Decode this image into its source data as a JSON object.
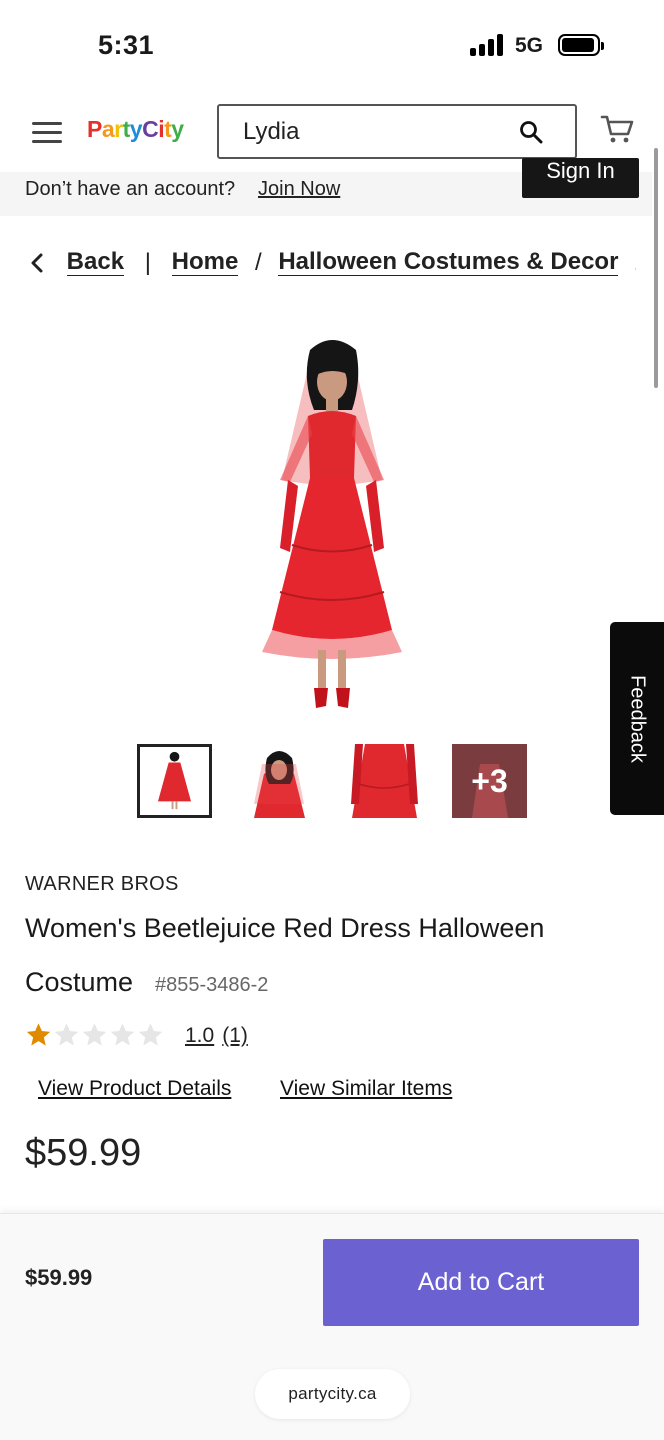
{
  "status_bar": {
    "time": "5:31",
    "network": "5G"
  },
  "header": {
    "logo": {
      "word1": "Party",
      "word2": "City",
      "colors": [
        "#e4322b",
        "#f39a1e",
        "#f2c200",
        "#3fae49",
        "#1f8dd6",
        "#6b3fa0",
        "#e4322b",
        "#f39a1e",
        "#3fae49"
      ]
    },
    "search": {
      "value": "Lydia",
      "placeholder": ""
    }
  },
  "account_bar": {
    "message": "Don’t have an account?",
    "join_label": "Join Now",
    "sign_in_label": "Sign In"
  },
  "breadcrumb": {
    "back": "Back",
    "items": [
      "Home",
      "Halloween Costumes & Decor",
      ""
    ],
    "separator": "/"
  },
  "feedback_label": "Feedback",
  "gallery": {
    "thumbnails": [
      "full-dress",
      "veil-closeup",
      "dress-detail"
    ],
    "more_label": "+3",
    "selected_index": 0
  },
  "product": {
    "brand": "WARNER BROS",
    "title_line1": "Women's Beetlejuice Red Dress Halloween",
    "title_line2": "Costume",
    "sku": "#855-3486-2",
    "rating_value": "1.0",
    "rating_count": "(1)",
    "rating_stars": 1,
    "rating_max": 5,
    "view_details": "View Product Details",
    "view_similar": "View Similar Items",
    "price": "$59.99"
  },
  "bottom_bar": {
    "price": "$59.99",
    "add_to_cart": "Add to Cart",
    "accent_color": "#6b61d1",
    "url": "partycity.ca"
  }
}
